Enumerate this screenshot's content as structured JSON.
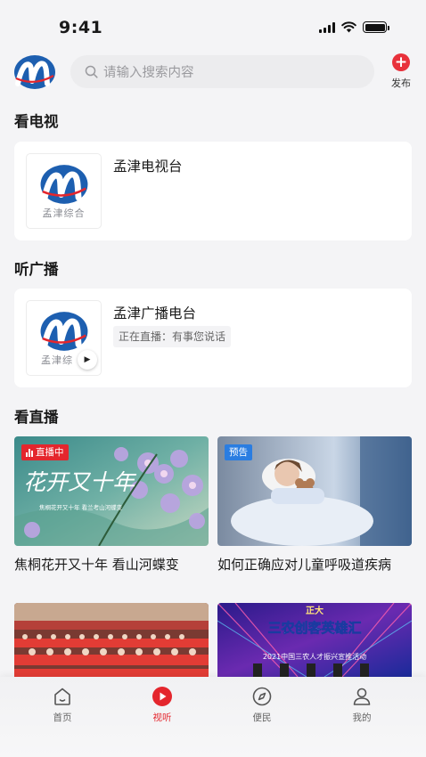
{
  "status_bar": {
    "time": "9:41"
  },
  "header": {
    "search_placeholder": "请输入搜索内容",
    "publish_label": "发布"
  },
  "sections": {
    "tv_title": "看电视",
    "radio_title": "听广播",
    "live_title": "看直播"
  },
  "tv_card": {
    "title": "孟津电视台",
    "thumb_caption": "孟津综合"
  },
  "radio_card": {
    "title": "孟津广播电台",
    "status": "正在直播：有事您说话",
    "thumb_caption": "孟津综"
  },
  "live_items": [
    {
      "badge": "直播中",
      "caption": "焦桐花开又十年 看山河蝶变",
      "image_text": "花开又十年",
      "image_sub": "焦桐花开又十年 看兰考山河蝶变"
    },
    {
      "badge": "预告",
      "caption": "如何正确应对儿童呼吸道疾病"
    },
    {
      "caption": ""
    },
    {
      "caption": "",
      "image_text": "三农创客英雄汇",
      "image_sub": "2021中国三农人才振兴宣推活动",
      "image_top": "正大"
    }
  ],
  "tabbar": {
    "tabs": [
      {
        "label": "首页",
        "icon": "home-icon"
      },
      {
        "label": "视听",
        "icon": "play-icon",
        "active": true
      },
      {
        "label": "便民",
        "icon": "compass-icon"
      },
      {
        "label": "我的",
        "icon": "user-icon"
      }
    ]
  },
  "colors": {
    "accent": "#e4262d",
    "brand_blue": "#1d5fb0",
    "preview_blue": "#2a7de1"
  }
}
